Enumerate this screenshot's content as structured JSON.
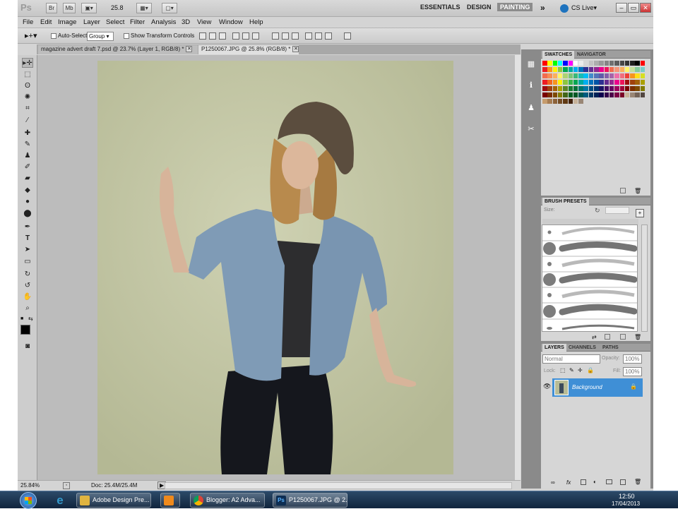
{
  "appbar": {
    "logo": "Ps",
    "br": "Br",
    "mb": "Mb",
    "zoom": "25.8",
    "workspaces": [
      "ESSENTIALS",
      "DESIGN",
      "PAINTING"
    ],
    "active_workspace": "PAINTING",
    "more": "»",
    "cs_live": "CS Live",
    "min": "–",
    "restore": "▭",
    "close": "✕"
  },
  "menus": [
    "File",
    "Edit",
    "Image",
    "Layer",
    "Select",
    "Filter",
    "Analysis",
    "3D",
    "View",
    "Window",
    "Help"
  ],
  "options": {
    "auto_select_label": "Auto-Select:",
    "auto_select_value": "Group",
    "show_transform_label": "Show Transform Controls"
  },
  "tabs": [
    {
      "label": "magazine advert draft 7.psd @ 23.7% (Layer 1, RGB/8) *",
      "active": false
    },
    {
      "label": "P1250067.JPG @ 25.8% (RGB/8) *",
      "active": true
    }
  ],
  "tab_close": "✕",
  "status": {
    "zoom": "25.84%",
    "doc": "Doc: 25.4M/25.4M",
    "arrow": "▶"
  },
  "panels": {
    "swatches_tabs": [
      "SWATCHES",
      "NAVIGATOR"
    ],
    "brush_tabs": [
      "BRUSH PRESETS"
    ],
    "brush_size_label": "Size:",
    "layers_tabs": [
      "LAYERS",
      "CHANNELS",
      "PATHS"
    ],
    "blend_mode": "Normal",
    "opacity_label": "Opacity:",
    "opacity_value": "100%",
    "lock_label": "Lock:",
    "fill_label": "Fill:",
    "fill_value": "100%",
    "layer_name": "Background"
  },
  "taskbar": {
    "buttons": [
      "Adobe Design Pre...",
      "Blogger: A2 Adva...",
      "P1250067.JPG @ 2..."
    ],
    "time": "12:50",
    "date": "17/04/2013"
  },
  "colors": {
    "accent_blue": "#3f8fd6",
    "painting_active": "#8c8c8c",
    "photo_background": "#c4c7a3"
  }
}
